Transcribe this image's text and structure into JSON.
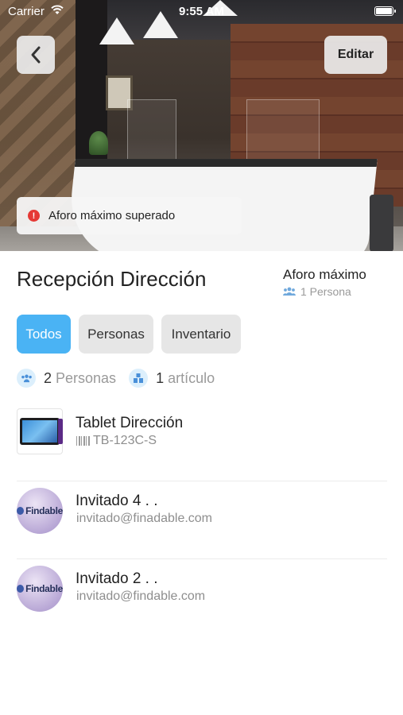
{
  "status_bar": {
    "carrier": "Carrier",
    "time": "9:55 AM"
  },
  "header": {
    "back_icon": "chevron-left-icon",
    "edit_label": "Editar"
  },
  "alert": {
    "icon": "alert-circle-icon",
    "text": "Aforo máximo superado",
    "color": "#e53935"
  },
  "location": {
    "title": "Recepción Dirección",
    "capacity_label": "Aforo máximo",
    "capacity_value": "1 Persona"
  },
  "tabs": [
    {
      "label": "Todos",
      "active": true
    },
    {
      "label": "Personas",
      "active": false
    },
    {
      "label": "Inventario",
      "active": false
    }
  ],
  "counts": {
    "people_count": "2",
    "people_label": "Personas",
    "items_count": "1",
    "items_label": "artículo"
  },
  "items": [
    {
      "type": "asset",
      "name": "Tablet Dirección",
      "code": "TB-123C-S"
    },
    {
      "type": "person",
      "name": "Invitado 4 . .",
      "email": "invitado@finadable.com",
      "avatar_text": "Findable"
    },
    {
      "type": "person",
      "name": "Invitado 2 . .",
      "email": "invitado@findable.com",
      "avatar_text": "Findable"
    }
  ],
  "colors": {
    "accent": "#4ab3f4",
    "muted": "#9a9a9a",
    "alert": "#e53935"
  }
}
